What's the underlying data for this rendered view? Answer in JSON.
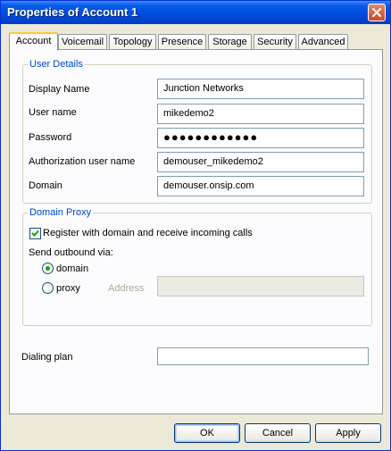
{
  "window": {
    "title": "Properties of Account 1"
  },
  "tabs": [
    "Account",
    "Voicemail",
    "Topology",
    "Presence",
    "Storage",
    "Security",
    "Advanced"
  ],
  "user_details": {
    "legend": "User Details",
    "display_name_label": "Display Name",
    "display_name_value": "Junction Networks",
    "user_name_label": "User name",
    "user_name_value": "mikedemo2",
    "password_label": "Password",
    "password_value": "●●●●●●●●●●●●",
    "auth_user_label": "Authorization user name",
    "auth_user_value": "demouser_mikedemo2",
    "domain_label": "Domain",
    "domain_value": "demouser.onsip.com"
  },
  "domain_proxy": {
    "legend": "Domain Proxy",
    "register_label": "Register with domain and receive incoming calls",
    "register_checked": true,
    "send_outbound_label": "Send outbound via:",
    "domain_option": "domain",
    "proxy_option": "proxy",
    "selected": "domain",
    "address_label": "Address",
    "address_value": ""
  },
  "dialing_plan": {
    "label": "Dialing plan",
    "value": ""
  },
  "buttons": {
    "ok": "OK",
    "cancel": "Cancel",
    "apply": "Apply"
  }
}
